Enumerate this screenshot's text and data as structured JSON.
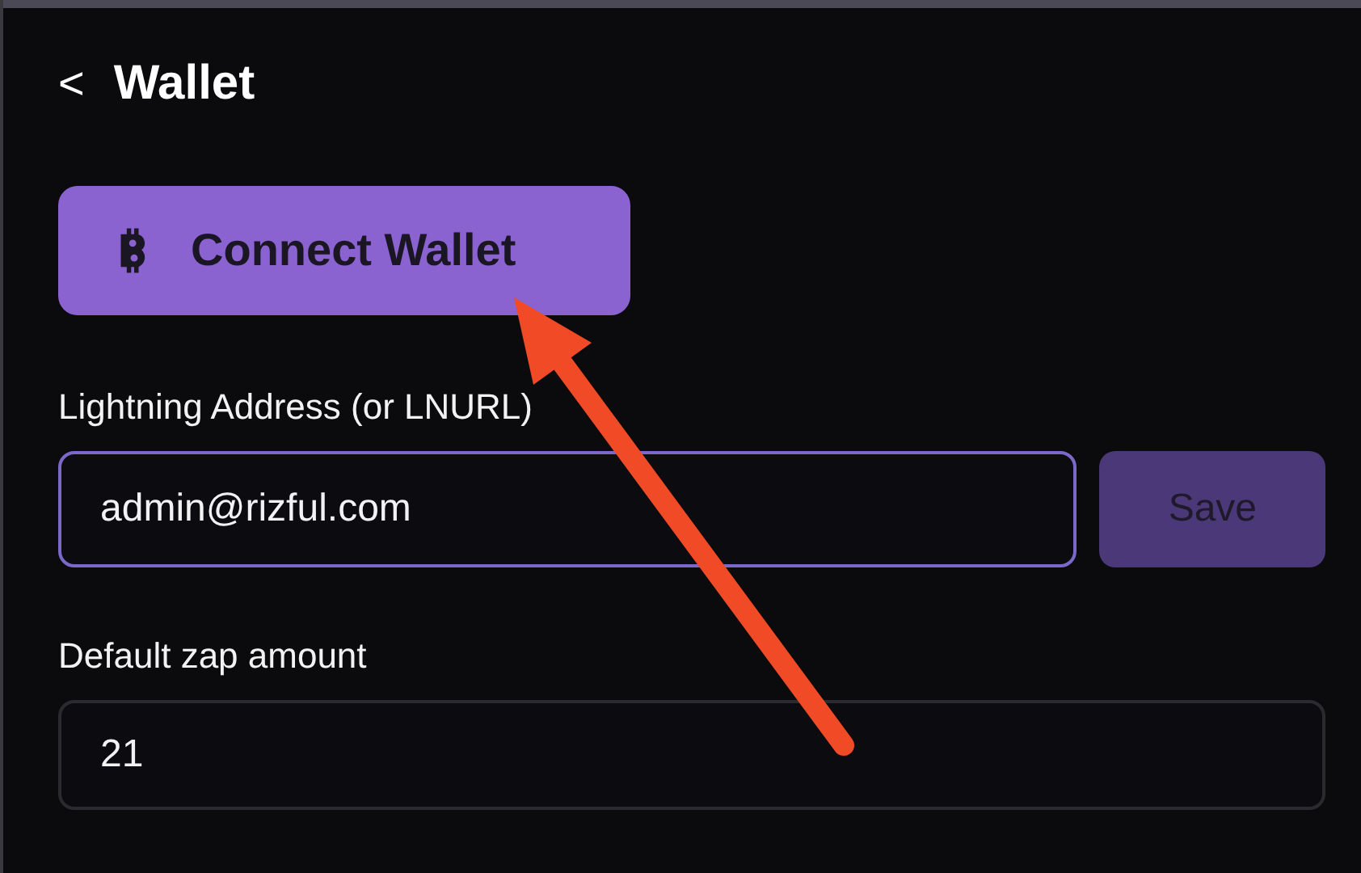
{
  "header": {
    "back_symbol": "<",
    "title": "Wallet"
  },
  "connect_button": {
    "label": "Connect Wallet"
  },
  "lightning_field": {
    "label": "Lightning Address (or LNURL)",
    "value": "admin@rizful.com",
    "focused": true,
    "button": "Save"
  },
  "zap_field": {
    "label": "Default zap amount",
    "value": "21",
    "focused": false
  }
}
